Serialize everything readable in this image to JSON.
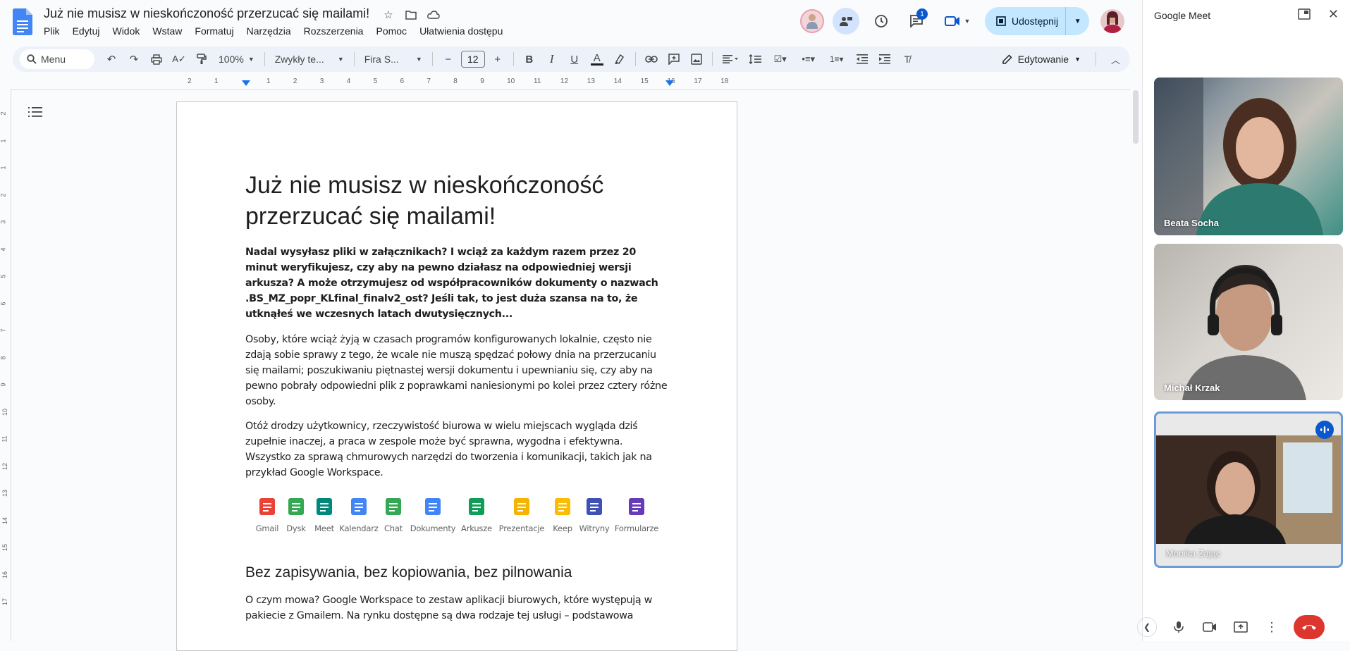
{
  "doc": {
    "title": "Już nie musisz w nieskończoność przerzucać się mailami!"
  },
  "menu": [
    "Plik",
    "Edytuj",
    "Widok",
    "Wstaw",
    "Formatuj",
    "Narzędzia",
    "Rozszerzenia",
    "Pomoc",
    "Ułatwienia dostępu"
  ],
  "topbar": {
    "comments_badge": "1",
    "share_label": "Udostępnij"
  },
  "toolbar": {
    "search_label": "Menu",
    "zoom": "100%",
    "style": "Zwykły te...",
    "font": "Fira S...",
    "font_size": "12",
    "mode": "Edytowanie"
  },
  "ruler": [
    "2",
    "1",
    "1",
    "2",
    "3",
    "4",
    "5",
    "6",
    "7",
    "8",
    "9",
    "10",
    "11",
    "12",
    "13",
    "14",
    "15",
    "16",
    "17",
    "18"
  ],
  "ruler_left": [
    "2",
    "1",
    "1",
    "2",
    "3",
    "4",
    "5",
    "6",
    "7",
    "8",
    "9",
    "10",
    "11",
    "12",
    "13",
    "14",
    "15",
    "16",
    "17"
  ],
  "content": {
    "heading": "Już nie musisz w nieskończoność przerzucać się mailami!",
    "lead": "Nadal wysyłasz pliki w załącznikach? I wciąż za każdym razem przez 20 minut weryfikujesz, czy aby na pewno działasz na odpowiedniej wersji arkusza? A może otrzymujesz od współpracowników dokumenty o nazwach .BS_MZ_popr_KLfinal_finalv2_ost? Jeśli tak, to jest duża szansa na to, że utknąłeś we wczesnych latach dwutysięcznych...",
    "para1": "Osoby, które wciąż żyją w czasach programów konfigurowanych lokalnie, często nie zdają sobie sprawy z tego, że wcale nie muszą spędzać połowy dnia na przerzucaniu się mailami; poszukiwaniu piętnastej wersji dokumentu i upewnianiu się, czy aby na pewno pobrały odpowiedni plik z poprawkami naniesionymi po kolei przez cztery różne osoby.",
    "para2": "Otóż drodzy użytkownicy, rzeczywistość biurowa w wielu miejscach wygląda dziś zupełnie inaczej, a praca w zespole może być sprawna, wygodna i efektywna. Wszystko za sprawą chmurowych narzędzi do tworzenia i komunikacji, takich jak na przykład Google Workspace.",
    "apps": [
      {
        "name": "Gmail",
        "icon": "gmail-icon",
        "color": "#ea4335"
      },
      {
        "name": "Dysk",
        "icon": "drive-icon",
        "color": "#34a853"
      },
      {
        "name": "Meet",
        "icon": "meet-icon",
        "color": "#00897b"
      },
      {
        "name": "Kalendarz",
        "icon": "calendar-icon",
        "color": "#4285f4"
      },
      {
        "name": "Chat",
        "icon": "chat-icon",
        "color": "#34a853"
      },
      {
        "name": "Dokumenty",
        "icon": "docs-icon",
        "color": "#4285f4"
      },
      {
        "name": "Arkusze",
        "icon": "sheets-icon",
        "color": "#0f9d58"
      },
      {
        "name": "Prezentacje",
        "icon": "slides-icon",
        "color": "#f4b400"
      },
      {
        "name": "Keep",
        "icon": "keep-icon",
        "color": "#fbbc04"
      },
      {
        "name": "Witryny",
        "icon": "sites-icon",
        "color": "#3f51b5"
      },
      {
        "name": "Formularze",
        "icon": "forms-icon",
        "color": "#673ab7"
      }
    ],
    "heading2": "Bez zapisywania, bez kopiowania, bez pilnowania",
    "para3": "O czym mowa? Google Workspace to zestaw aplikacji biurowych, które występują w pakiecie z Gmailem. Na rynku dostępne są dwa rodzaje tej usługi – podstawowa"
  },
  "meet": {
    "title": "Google Meet",
    "participants": [
      {
        "name": "Beata Socha"
      },
      {
        "name": "Michał Krzak"
      },
      {
        "name": "Monika Zając",
        "speaking": true
      }
    ]
  },
  "colors": {
    "accent": "#0b57d0",
    "share_bg": "#c2e7ff",
    "toolbar_bg": "#edf2fa",
    "hangup": "#dc362e"
  }
}
